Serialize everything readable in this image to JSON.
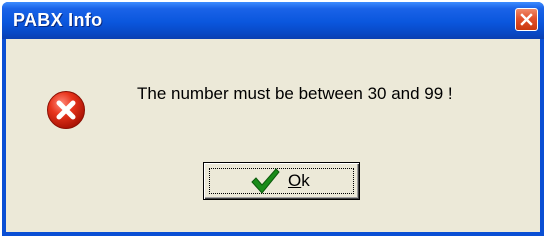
{
  "window": {
    "title": "PABX Info",
    "close_icon": "close-icon"
  },
  "dialog": {
    "icon": "error-icon",
    "message": "The number must be between 30 and 99 !",
    "ok_button": {
      "icon": "checkmark-icon",
      "mnemonic": "O",
      "label_rest": "k"
    }
  },
  "colors": {
    "titlebar": "#0a56dd",
    "client_background": "#ece9d8",
    "error_red": "#d81e06",
    "check_green": "#1a8c1a"
  }
}
